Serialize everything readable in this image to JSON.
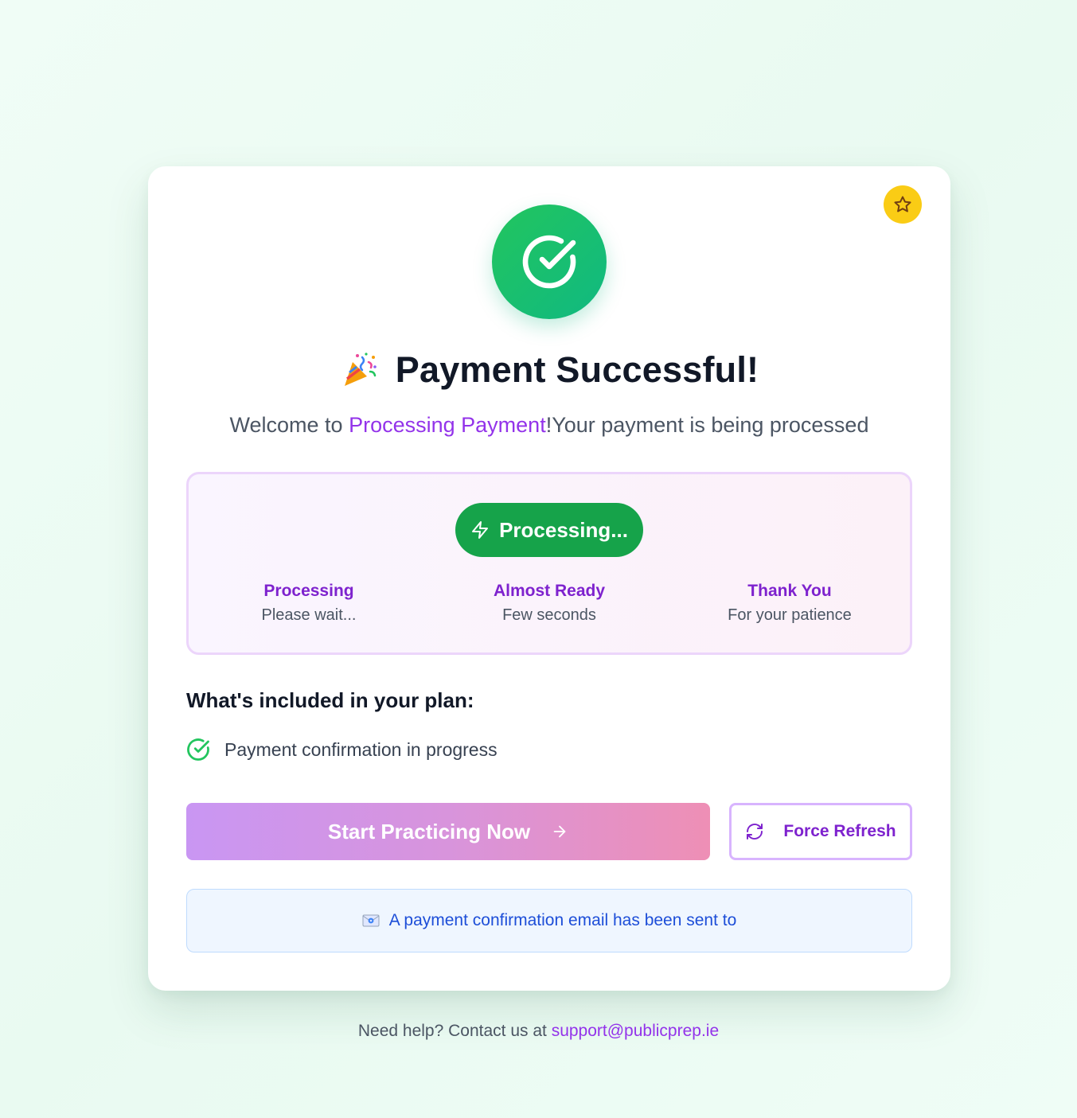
{
  "header": {
    "title": "Payment Successful!",
    "welcome_prefix": "Welcome to ",
    "welcome_highlight": "Processing Payment",
    "welcome_suffix": "!Your payment is being processed"
  },
  "status": {
    "pill_label": "Processing...",
    "steps": [
      {
        "title": "Processing",
        "subtitle": "Please wait..."
      },
      {
        "title": "Almost Ready",
        "subtitle": "Few seconds"
      },
      {
        "title": "Thank You",
        "subtitle": "For your patience"
      }
    ]
  },
  "plan": {
    "heading": "What's included in your plan:",
    "items": [
      "Payment confirmation in progress"
    ]
  },
  "actions": {
    "start_label": "Start Practicing Now",
    "refresh_label": "Force Refresh"
  },
  "notice": {
    "email_text": "A payment confirmation email has been sent to"
  },
  "footer": {
    "help_text": "Need help? Contact us at ",
    "support_email": "support@publicprep.ie"
  },
  "icons": {
    "badge": "star-icon",
    "success": "check-circle-icon",
    "title": "party-popper-icon",
    "pill": "lightning-icon",
    "plan_item": "check-circle-icon",
    "start": "arrow-right-icon",
    "refresh": "refresh-icon",
    "notice": "envelope-icon"
  },
  "colors": {
    "success_green": "#22c55e",
    "accent_purple": "#9333ea",
    "badge_yellow": "#facc15",
    "pill_green": "#16a34a",
    "notice_blue": "#1d4ed8"
  }
}
